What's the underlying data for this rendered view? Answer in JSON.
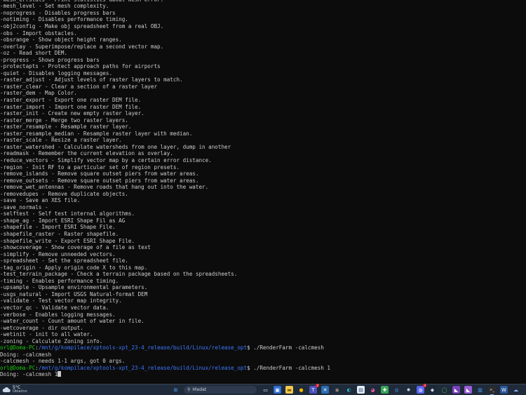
{
  "terminal": {
    "lines": [
      {
        "text": "-mesh_errstats - Print statistics about mesh error."
      },
      {
        "text": "-mesh_level - Set mesh complexity."
      },
      {
        "text": "-noprogress - Disables progress bars"
      },
      {
        "text": "-notiming - Disables performance timing."
      },
      {
        "text": "-obj2config - Make obj spreadsheet from a real OBJ."
      },
      {
        "text": "-obs - Import obstacles."
      },
      {
        "text": "-obsrange - Show object height ranges."
      },
      {
        "text": "-overlay - Superimpose/replace a second vector map."
      },
      {
        "text": "-oz - Read short DEM."
      },
      {
        "text": "-progress - Shows progress bars"
      },
      {
        "text": "-protectapts - Protect approach paths for airports"
      },
      {
        "text": "-quiet - Disables logging messages."
      },
      {
        "text": "-raster_adjust - Adjust levels of raster layers to match."
      },
      {
        "text": "-raster_clear - Clear a section of a raster layer"
      },
      {
        "text": "-raster_dem - Map Color."
      },
      {
        "text": "-raster_export - Export one raster DEM file."
      },
      {
        "text": "-raster_import - Import one raster DEM file."
      },
      {
        "text": "-raster_init - Create new empty raster layer."
      },
      {
        "text": "-raster_merge - Merge two raster layers."
      },
      {
        "text": "-raster_resample - Resample raster layer."
      },
      {
        "text": "-raster_resample_median - Resample raster layer with median."
      },
      {
        "text": "-raster_scale - Resize a raster layer."
      },
      {
        "text": "-raster_watershed - Calculate watersheds from one layer, dump in another"
      },
      {
        "text": "-readmask - Remember the current elevation as overlay."
      },
      {
        "text": "-reduce_vectors - Simplify vector map by a certain error distance."
      },
      {
        "text": "-region - Init RF to a particular set of region presets."
      },
      {
        "text": "-remove_islands - Remove square outset piers from water areas."
      },
      {
        "text": "-remove_outsets - Remove square outset piers from water areas."
      },
      {
        "text": "-remove_wet_antennas - Remove roads that hang out into the water."
      },
      {
        "text": "-removedupes - Remove duplicate objects."
      },
      {
        "text": "-save - Save an XES file."
      },
      {
        "text": "-save_normals -"
      },
      {
        "text": "-selftest - Self test internal algorithms."
      },
      {
        "text": "-shape_ag - Import ESRI Shape Fil as AG"
      },
      {
        "text": "-shapefile - Import ESRI Shape File."
      },
      {
        "text": "-shapefile_raster - Raster shapefile."
      },
      {
        "text": "-shapefile_write - Export ESRI Shape File."
      },
      {
        "text": "-showcoverage - Show coverage of a file as text"
      },
      {
        "text": "-simplify - Remove unneeded vectors."
      },
      {
        "text": "-spreadsheet - Set the spreadsheet file."
      },
      {
        "text": "-tag_origin - Apply origin code X to this map."
      },
      {
        "text": "-test_terrain_package - Check a terrain package based on the spreadsheets."
      },
      {
        "text": "-timing - Enables performance timing."
      },
      {
        "text": "-upsample - Upsample environmental parameters."
      },
      {
        "text": "-usgs_natural - Import USGS Natural-format DEM"
      },
      {
        "text": "-validate - Test vector map integrity."
      },
      {
        "text": "-vector_qc - Validate vector data."
      },
      {
        "text": "-verbose - Enables logging messages."
      },
      {
        "text": "-water_count - Count amount of water in file."
      },
      {
        "text": "-wetcoverage - dir output."
      },
      {
        "text": "-wetinit - init to all water."
      },
      {
        "text": "-zoning - Calculate Zoning info."
      },
      {
        "prompt": true,
        "user": "orl@Doma-PC",
        "path": "/mnt/g/kompilace/xptools-xpt_23-4_release/build/Linux/release_opt",
        "command": "./RenderFarm -calcmesh"
      },
      {
        "text": "Doing: -calcmesh"
      },
      {
        "text": "-calcmesh - needs 1-1 args, got 0 args."
      },
      {
        "prompt": true,
        "user": "orl@Doma-PC",
        "path": "/mnt/g/kompilace/xptools-xpt_23-4_release/build/Linux/release_opt",
        "command": "./RenderFarm -calcmesh 1"
      },
      {
        "text": "Doing: -calcmesh 1",
        "cursor": true
      }
    ]
  },
  "taskbar": {
    "weather": {
      "temp": "5°C",
      "condition": "Oblačno"
    },
    "search_placeholder": "Hledat",
    "colors": {
      "background": "#1f2a3a",
      "prompt_user": "#16c60c",
      "prompt_path": "#3b78ff"
    },
    "apps": [
      {
        "name": "windows-start-icon",
        "glyph": "⊞",
        "bg": "transparent",
        "color": "#4aa3ff"
      },
      {
        "name": "search"
      },
      {
        "name": "task-view-icon",
        "glyph": "▭",
        "bg": "transparent",
        "color": "#ffffff"
      },
      {
        "name": "store-icon",
        "glyph": "▣",
        "bg": "#2d6fd6",
        "color": "#ffffff"
      },
      {
        "name": "file-explorer-icon",
        "glyph": "▬",
        "bg": "#f2c94c",
        "color": "#7a5c00"
      },
      {
        "name": "chrome-icon",
        "glyph": "●",
        "bg": "transparent",
        "color": "#f4b400"
      },
      {
        "name": "teams-icon",
        "glyph": "T",
        "bg": "#4b53bc",
        "color": "#ffffff",
        "badge": "2"
      },
      {
        "name": "x-app-icon",
        "glyph": "✕",
        "bg": "#2b6cb0",
        "color": "#ffffff"
      },
      {
        "name": "gimp-icon",
        "glyph": "◉",
        "bg": "transparent",
        "color": "#9c8f7a"
      },
      {
        "name": "edge-icon",
        "glyph": "◐",
        "bg": "transparent",
        "color": "#2fb8c4"
      },
      {
        "name": "notepad-icon",
        "glyph": "▤",
        "bg": "#e8eef5",
        "color": "#2a4d7a"
      },
      {
        "name": "palette-icon",
        "glyph": "◕",
        "bg": "transparent",
        "color": "#e05a9c"
      },
      {
        "name": "puzzle-app-icon",
        "glyph": "✚",
        "bg": "#3aa655",
        "color": "#ffffff"
      },
      {
        "name": "globe-app-icon",
        "glyph": "◎",
        "bg": "transparent",
        "color": "#4da3ff"
      },
      {
        "name": "settings-gear-icon",
        "glyph": "✹",
        "bg": "transparent",
        "color": "#c8d0dc"
      },
      {
        "name": "discord-icon",
        "glyph": "◍",
        "bg": "#5865f2",
        "color": "#ffffff",
        "badge": "3"
      },
      {
        "name": "steam-icon",
        "glyph": "◆",
        "bg": "#1b2838",
        "color": "#c7d5e0"
      },
      {
        "name": "xbox-icon",
        "glyph": "◯",
        "bg": "transparent",
        "color": "#49c24b"
      },
      {
        "name": "visual-studio-icon",
        "glyph": "◣",
        "bg": "#7b42bc",
        "color": "#ffffff"
      },
      {
        "name": "visual-studio-preview-icon",
        "glyph": "◣",
        "bg": "#9b5fd6",
        "color": "#ffffff"
      },
      {
        "name": "task-manager-icon",
        "glyph": "▥",
        "bg": "transparent",
        "color": "#4da3ff"
      },
      {
        "name": "terminal-icon",
        "glyph": ">_",
        "bg": "#2b2b2b",
        "color": "#ffffff",
        "active": true
      },
      {
        "name": "word-icon",
        "glyph": "W",
        "bg": "#2b579a",
        "color": "#ffffff"
      },
      {
        "name": "cloud-app-icon",
        "glyph": "☁",
        "bg": "transparent",
        "color": "#8ab4f8"
      }
    ]
  }
}
